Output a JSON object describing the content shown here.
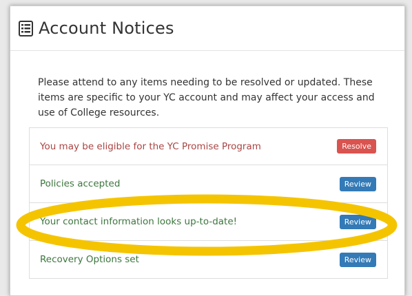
{
  "header": {
    "icon": "list-alt-icon",
    "title": "Account Notices"
  },
  "intro": {
    "text": "Please attend to any items needing to be resolved or updated. These items are specific to your YC account and may affect your access and use of College resources."
  },
  "notices": [
    {
      "label": "You may be eligible for the YC Promise Program",
      "button": "Resolve",
      "text_color": "#a94442",
      "button_color": "#d9534f"
    },
    {
      "label": "Policies accepted",
      "button": "Review",
      "text_color": "#3c763d",
      "button_color": "#337ab7"
    },
    {
      "label": "Your contact information looks up-to-date!",
      "button": "Review",
      "text_color": "#3c763d",
      "button_color": "#337ab7"
    },
    {
      "label": "Recovery Options set",
      "button": "Review",
      "text_color": "#3c763d",
      "button_color": "#337ab7"
    }
  ],
  "highlight": {
    "shape": "ellipse",
    "color": "#f5c400"
  }
}
